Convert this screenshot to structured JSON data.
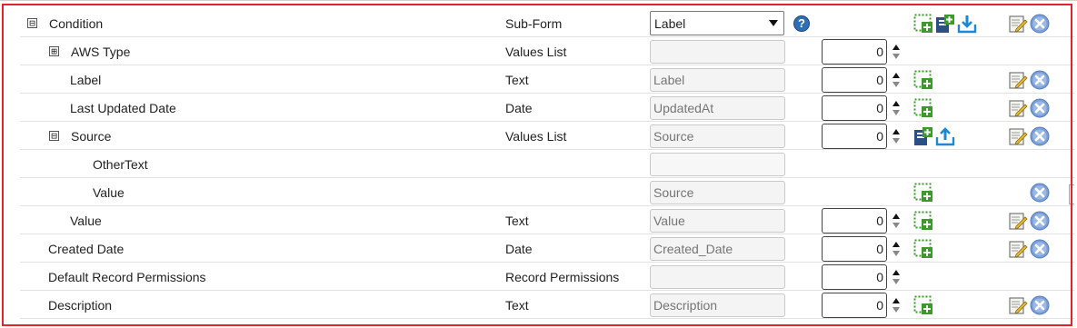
{
  "rows": [
    {
      "name": "Condition",
      "type": "Sub-Form",
      "select_value": "Label"
    },
    {
      "name": "AWS Type",
      "type": "Values List",
      "field": "",
      "order": "0"
    },
    {
      "name": "Label",
      "type": "Text",
      "field": "Label",
      "order": "0"
    },
    {
      "name": "Last Updated Date",
      "type": "Date",
      "field": "UpdatedAt",
      "order": "0"
    },
    {
      "name": "Source",
      "type": "Values List",
      "field": "Source",
      "order": "0"
    },
    {
      "name": "OtherText",
      "type": "",
      "field": ""
    },
    {
      "name": "Value",
      "type": "",
      "field": "Source"
    },
    {
      "name": "Value",
      "type": "Text",
      "field": "Value",
      "order": "0"
    },
    {
      "name": "Created Date",
      "type": "Date",
      "field": "Created_Date",
      "order": "0"
    },
    {
      "name": "Default Record Permissions",
      "type": "Record Permissions",
      "field": "",
      "order": "0"
    },
    {
      "name": "Description",
      "type": "Text",
      "field": "Description",
      "order": "0"
    }
  ],
  "expanders": {
    "collapse": "⊟",
    "expand": "⊞"
  },
  "help_glyph": "?",
  "colors": {
    "frame": "#e0242b",
    "help": "#2f6db5",
    "add_green": "#3a9a2a",
    "remove_blue": "#7a9fd6"
  },
  "icons": [
    "add-field-icon",
    "import-field-icon",
    "download-icon",
    "edit-icon",
    "remove-icon",
    "help-icon",
    "collapse-icon",
    "expand-icon"
  ]
}
